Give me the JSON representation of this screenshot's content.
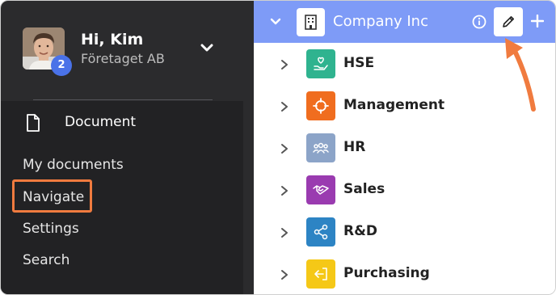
{
  "user": {
    "greeting": "Hi, Kim",
    "company": "Företaget AB",
    "notification_count": "2"
  },
  "menu": {
    "header_label": "Document",
    "items": [
      {
        "label": "My documents"
      },
      {
        "label": "Navigate"
      },
      {
        "label": "Settings"
      },
      {
        "label": "Search"
      }
    ]
  },
  "tree": {
    "root_label": "Company Inc",
    "nodes": [
      {
        "label": "HSE",
        "icon": "hand-heart-icon",
        "color": "#2fb38f"
      },
      {
        "label": "Management",
        "icon": "target-icon",
        "color": "#f06d1f"
      },
      {
        "label": "HR",
        "icon": "people-icon",
        "color": "#8ca4c8"
      },
      {
        "label": "Sales",
        "icon": "handshake-icon",
        "color": "#9a3bb0"
      },
      {
        "label": "R&D",
        "icon": "share-icon",
        "color": "#2d84c4"
      },
      {
        "label": "Purchasing",
        "icon": "login-icon",
        "color": "#f5c817"
      }
    ]
  },
  "colors": {
    "sidebar_bg": "#2b2b2d",
    "menu_bg": "#222224",
    "topbar_bg": "#7e9bf7",
    "highlight": "#f07b3f"
  }
}
